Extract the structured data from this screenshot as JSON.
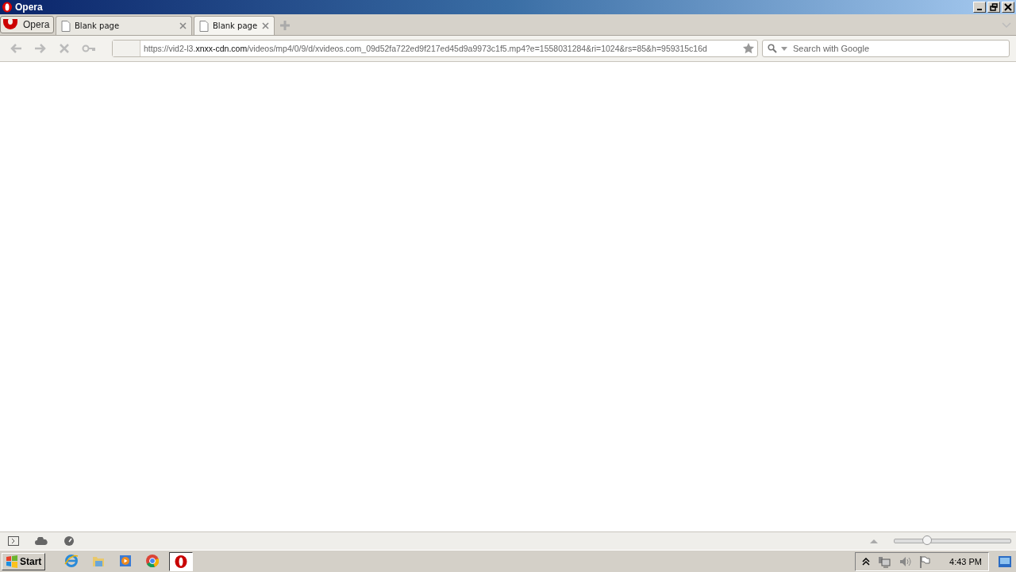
{
  "window": {
    "title": "Opera"
  },
  "menu_button": {
    "label": "Opera"
  },
  "tabs": [
    {
      "label": "Blank page",
      "selected": false
    },
    {
      "label": "Blank page",
      "selected": true
    }
  ],
  "address_bar": {
    "url_prefix": "https://vid2-l3.",
    "url_domain": "xnxx-cdn.com",
    "url_rest": "/videos/mp4/0/9/d/xvideos.com_09d52fa722ed9f217ed45d9a9973c1f5.mp4?e=1558031284&ri=1024&rs=85&h=959315c16d"
  },
  "search": {
    "placeholder": "Search with Google"
  },
  "status_bar": {
    "zoom": {
      "level": 0.28
    }
  },
  "taskbar": {
    "start": "Start",
    "apps": [
      {
        "kind": "ie",
        "selected": false
      },
      {
        "kind": "folder",
        "selected": false
      },
      {
        "kind": "media",
        "selected": false
      },
      {
        "kind": "chrome",
        "selected": false
      },
      {
        "kind": "opera",
        "selected": true
      }
    ],
    "clock": "4:43 PM"
  }
}
